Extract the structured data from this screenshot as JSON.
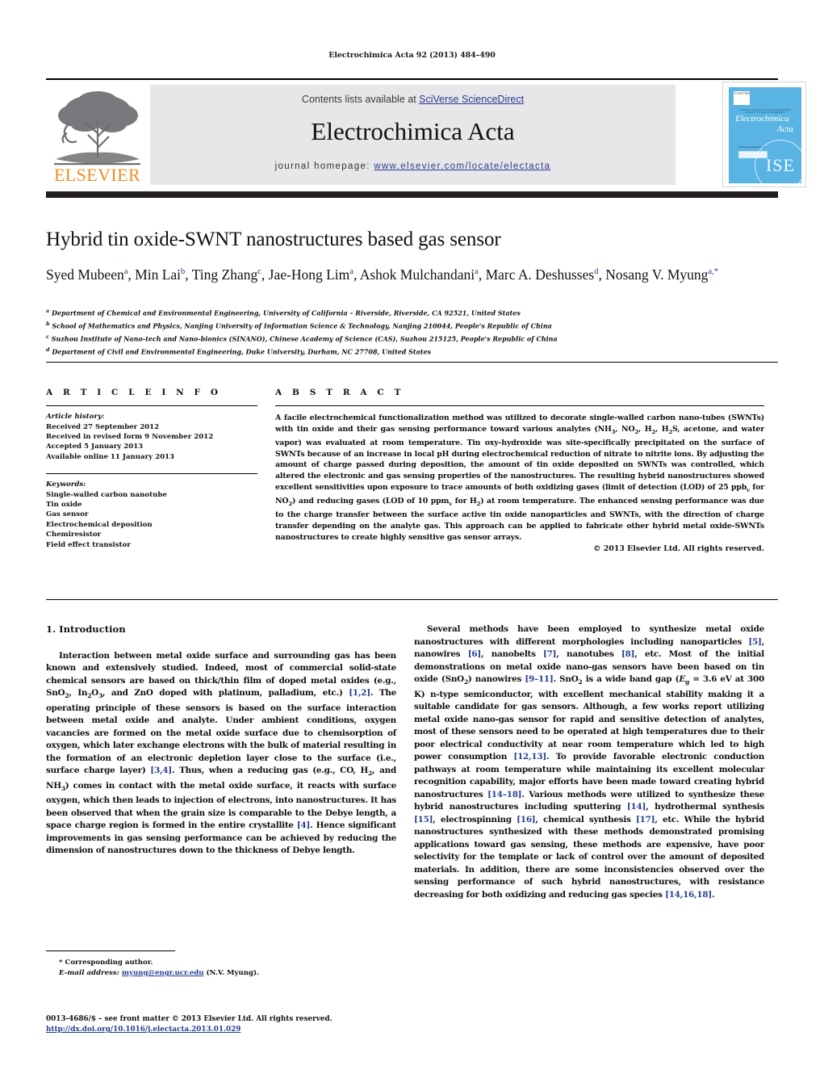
{
  "running_head": "Electrochimica Acta 92 (2013) 484–490",
  "journal_header": {
    "contents_prefix": "Contents lists available at ",
    "sciencedirect_link": "SciVerse ScienceDirect",
    "journal_title": "Electrochimica Acta",
    "homepage_label": "journal homepage: ",
    "homepage_link": "www.elsevier.com/locate/electacta",
    "publisher_logo_text": "ELSEVIER",
    "cover": {
      "title_line1": "Electrochimica",
      "title_line2": "Acta",
      "top_micro_text": "OFFICIAL JOURNAL OF THE INTERNATIONAL SOCIETY OF ELECTROCHEMISTRY",
      "box_micro_text": "Published in association with",
      "box_label": "ScienceDirect",
      "society_mark": "ISE"
    },
    "band_bg": "#e7e7e9",
    "link_color": "#2b3b8c",
    "dark_bar_color": "#231f20",
    "cover_bg": "#59b4e4",
    "elsevier_orange": "#F08C1E"
  },
  "article": {
    "title": "Hybrid tin oxide-SWNT nanostructures based gas sensor",
    "authors_html": "Syed Mubeen<sup>a</sup>, Min Lai<sup>b</sup>, Ting Zhang<sup>c</sup>, Jae-Hong Lim<sup>a</sup>, Ashok Mulchandani<sup>a</sup>, Marc A. Deshusses<sup>d</sup>, Nosang V. Myung<sup>a,*</sup>",
    "affiliations": [
      {
        "mark": "a",
        "text": "Department of Chemical and Environmental Engineering, University of California – Riverside, Riverside, CA 92521, United States"
      },
      {
        "mark": "b",
        "text": "School of Mathematics and Physics, Nanjing University of Information Science & Technology, Nanjing 210044, People's Republic of China"
      },
      {
        "mark": "c",
        "text": "Suzhou Institute of Nano-tech and Nano-bionics (SINANO), Chinese Academy of Science (CAS), Suzhou 215125, People's Republic of China"
      },
      {
        "mark": "d",
        "text": "Department of Civil and Environmental Engineering, Duke University, Durham, NC 27708, United States"
      }
    ]
  },
  "article_info": {
    "heading": "A R T I C L E    I N F O",
    "history_label": "Article history:",
    "history": [
      "Received 27 September 2012",
      "Received in revised form 9 November 2012",
      "Accepted 5 January 2013",
      "Available online 11 January 2013"
    ],
    "keywords_label": "Keywords:",
    "keywords": [
      "Single-walled carbon nanotube",
      "Tin oxide",
      "Gas sensor",
      "Electrochemical deposition",
      "Chemiresistor",
      "Field effect transistor"
    ]
  },
  "abstract": {
    "heading": "A B S T R A C T",
    "body_html": "A facile electrochemical functionalization method was utilized to decorate single-walled carbon nano-tubes (SWNTs) with tin oxide and their gas sensing performance toward various analytes (NH<sub>3</sub>, NO<sub>2</sub>, H<sub>2</sub>, H<sub>2</sub>S, acetone, and water vapor) was evaluated at room temperature. Tin oxy-hydroxide was site-specifically precipitated on the surface of SWNTs because of an increase in local pH during electrochemical reduction of nitrate to nitrite ions. By adjusting the amount of charge passed during deposition, the amount of tin oxide deposited on SWNTs was controlled, which altered the electronic and gas sensing properties of the nanostructures. The resulting hybrid nanostructures showed excellent sensitivities upon exposure to trace amounts of both oxidizing gases (limit of detection (LOD) of 25 ppb<sub>v</sub> for NO<sub>2</sub>) and reducing gases (LOD of 10 ppm<sub>v</sub> for H<sub>2</sub>) at room temperature. The enhanced sensing performance was due to the charge transfer between the surface active tin oxide nanoparticles and SWNTs, with the direction of charge transfer depending on the analyte gas. This approach can be applied to fabricate other hybrid metal oxide-SWNTs nanostructures to create highly sensitive gas sensor arrays.",
    "copyright": "© 2013 Elsevier Ltd. All rights reserved."
  },
  "body": {
    "section_heading": "1.  Introduction",
    "left_paragraph_html": "Interaction between metal oxide surface and surrounding gas has been known and extensively studied. Indeed, most of commercial solid-state chemical sensors are based on thick/thin film of doped metal oxides (e.g., SnO<sub>2</sub>, In<sub>2</sub>O<sub>3</sub>, and ZnO doped with platinum, palladium, etc.) <span class=\"ref\">[1,2]</span>. The operating principle of these sensors is based on the surface interaction between metal oxide and analyte. Under ambient conditions, oxygen vacancies are formed on the metal oxide surface due to chemisorption of oxygen, which later exchange electrons with the bulk of material resulting in the formation of an electronic depletion layer close to the surface (i.e., surface charge layer) <span class=\"ref\">[3,4]</span>. Thus, when a reducing gas (e.g., CO, H<sub>2</sub>, and NH<sub>3</sub>) comes in contact with the metal oxide surface, it reacts with surface oxygen, which then leads to injection of electrons, into nanostructures. It has been observed that when the grain size is comparable to the Debye length, a space charge region is formed in the entire crystallite <span class=\"ref\">[4]</span>. Hence significant improvements in gas sensing performance can be achieved by reducing the dimension of nanostructures down to the thickness of Debye length.",
    "right_paragraph_html": "Several methods have been employed to synthesize metal oxide nanostructures with different morphologies including nanoparticles <span class=\"ref\">[5]</span>, nanowires <span class=\"ref\">[6]</span>, nanobelts <span class=\"ref\">[7]</span>, nanotubes <span class=\"ref\">[8]</span>, etc. Most of the initial demonstrations on metal oxide nano-gas sensors have been based on tin oxide (SnO<sub>2</sub>) nanowires <span class=\"ref\">[9–11]</span>. SnO<sub>2</sub> is a wide band gap (<i>E</i><sub>g</sub> = 3.6 eV at 300 K) n-type semiconductor, with excellent mechanical stability making it a suitable candidate for gas sensors. Although, a few works report utilizing metal oxide nano-gas sensor for rapid and sensitive detection of analytes, most of these sensors need to be operated at high temperatures due to their poor electrical conductivity at near room temperature which led to high power consumption <span class=\"ref\">[12,13]</span>. To provide favorable electronic conduction pathways at room temperature while maintaining its excellent molecular recognition capability, major efforts have been made toward creating hybrid nanostructures <span class=\"ref\">[14–18]</span>. Various methods were utilized to synthesize these hybrid nanostructures including sputtering <span class=\"ref\">[14]</span>, hydrothermal synthesis <span class=\"ref\">[15]</span>, electrospinning <span class=\"ref\">[16]</span>, chemical synthesis <span class=\"ref\">[17]</span>, etc. While the hybrid nanostructures synthesized with these methods demonstrated promising applications toward gas sensing, these methods are expensive, have poor selectivity for the template or lack of control over the amount of deposited materials. In addition, there are some inconsistencies observed over the sensing performance of such hybrid nanostructures, with resistance decreasing for both oxidizing and reducing gas species <span class=\"ref\">[14,16,18]</span>."
  },
  "footer": {
    "corresponding_author": "* Corresponding author.",
    "email_label": "E-mail address:",
    "email": "myung@engr.ucr.edu",
    "email_suffix": "(N.V. Myung).",
    "front_matter": "0013-4686/$ – see front matter © 2013 Elsevier Ltd. All rights reserved.",
    "doi": "http://dx.doi.org/10.1016/j.electacta.2013.01.029"
  }
}
